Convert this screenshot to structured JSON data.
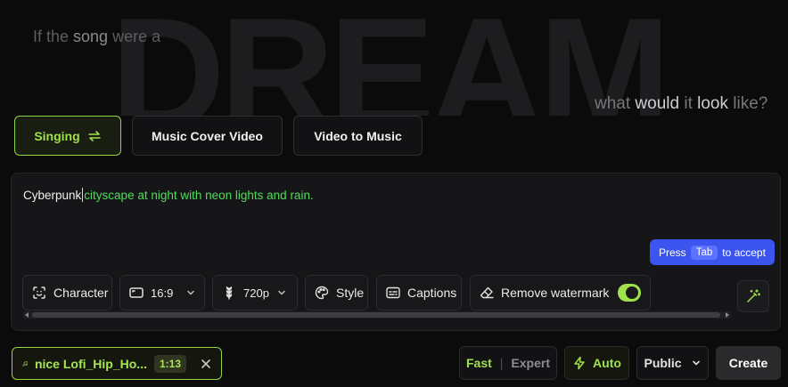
{
  "hero": {
    "background_word": "DREAM",
    "left_text": {
      "part1": "If the ",
      "emph1": "song",
      " part2": "",
      "part2": " were a"
    },
    "right_text": {
      "part1": "what ",
      "emph1": "would",
      "part2": " it ",
      "emph2": "look",
      "part3": " like?"
    }
  },
  "modes": {
    "singing_label": "Singing",
    "cover_video_label": "Music Cover Video",
    "video_to_music_label": "Video to Music"
  },
  "prompt": {
    "typed": "Cyberpunk",
    "suggestion": "cityscape at night with neon lights and rain.",
    "hint_press": "Press",
    "hint_key": "Tab",
    "hint_action": "to accept"
  },
  "toolbar": {
    "character_label": "Character",
    "aspect_value": "16:9",
    "resolution_value": "720p",
    "style_label": "Style",
    "captions_label": "Captions",
    "watermark_label": "Remove watermark",
    "watermark_enabled": true
  },
  "track": {
    "name": "nice Lofi_Hip_Ho...",
    "duration": "1:13"
  },
  "actions": {
    "fast_label": "Fast",
    "separator": "|",
    "expert_label": "Expert",
    "auto_label": "Auto",
    "visibility_value": "Public",
    "create_label": "Create"
  },
  "colors": {
    "accent_green": "#9fe24b",
    "suggestion_green": "#4fdc5a",
    "hint_blue": "#3b55ee",
    "background": "#0b0b0c"
  }
}
